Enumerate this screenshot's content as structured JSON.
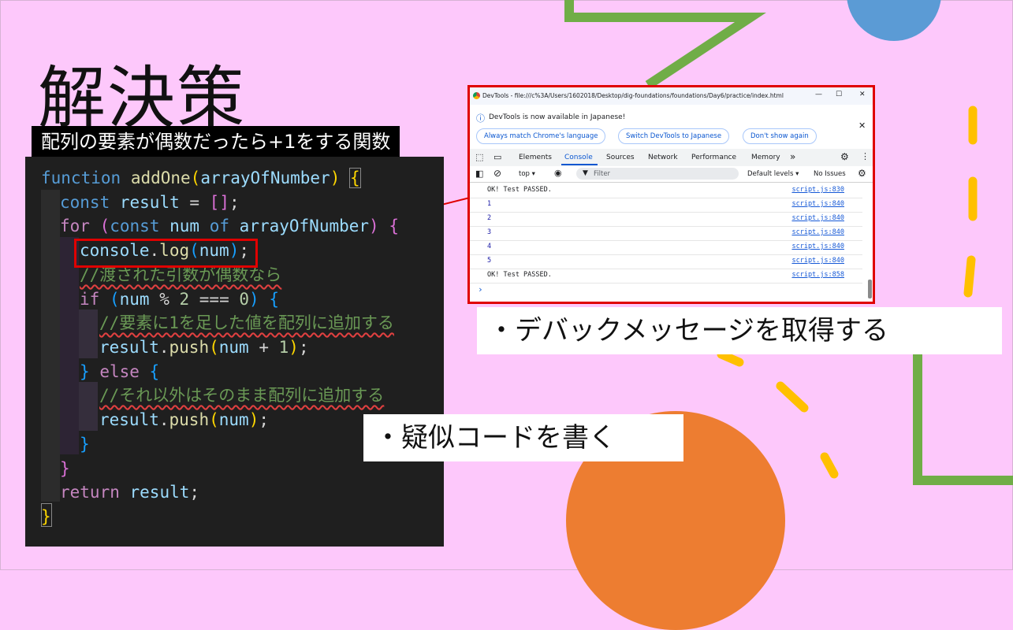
{
  "slide": {
    "title": "解決策",
    "subtitle": "配列の要素が偶数だったら+1をする関数"
  },
  "code": {
    "l1_kw": "function",
    "l1_fn": "addOne",
    "l1_open": "(",
    "l1_param": "arrayOfNumber",
    "l1_close": ")",
    "l1_brace": "{",
    "l2_kw": "const",
    "l2_var": "result",
    "l2_op": " = ",
    "l2_arr": "[]",
    "l2_semi": ";",
    "l3_kw": "for",
    "l3_open": "(",
    "l3_const": "const",
    "l3_var": "num",
    "l3_of": "of",
    "l3_param": "arrayOfNumber",
    "l3_close": ")",
    "l3_brace": "{",
    "l4_obj": "console",
    "l4_dot": ".",
    "l4_fn": "log",
    "l4_open": "(",
    "l4_var": "num",
    "l4_close": ")",
    "l4_semi": ";",
    "l5_comment": "//渡された引数が偶数なら",
    "l6_kw": "if",
    "l6_open": "(",
    "l6_var": "num",
    "l6_op1": " % ",
    "l6_n1": "2",
    "l6_op2": " === ",
    "l6_n2": "0",
    "l6_close": ")",
    "l6_brace": "{",
    "l7_comment": "//要素に1を足した値を配列に追加する",
    "l8_var": "result",
    "l8_dot": ".",
    "l8_fn": "push",
    "l8_open": "(",
    "l8_var2": "num",
    "l8_op": " + ",
    "l8_n": "1",
    "l8_close": ")",
    "l8_semi": ";",
    "l9_brace": "}",
    "l9_else": "else",
    "l9_brace2": "{",
    "l10_comment": "//それ以外はそのまま配列に追加する",
    "l11_var": "result",
    "l11_dot": ".",
    "l11_fn": "push",
    "l11_open": "(",
    "l11_var2": "num",
    "l11_close": ")",
    "l11_semi": ";",
    "l12_brace": "}",
    "l13_brace": "}",
    "l14_kw": "return",
    "l14_var": "result",
    "l14_semi": ";",
    "l15_brace": "}"
  },
  "devtools": {
    "window_title": "DevTools - file:///c%3A/Users/1602018/Desktop/dig-foundations/foundations/Day6/practice/index.html",
    "minimize_glyph": "—",
    "maximize_glyph": "☐",
    "close_glyph": "✕",
    "info_glyph": "ⓘ",
    "info_text": "DevTools is now available in Japanese!",
    "chip_match": "Always match Chrome's language",
    "chip_switch": "Switch DevTools to Japanese",
    "chip_dont": "Don't show again",
    "dismiss_glyph": "✕",
    "tabs": [
      "Elements",
      "Console",
      "Sources",
      "Network",
      "Performance",
      "Memory"
    ],
    "more_tabs_glyph": "»",
    "context": "top ▾",
    "filter_placeholder": "Filter",
    "levels": "Default levels ▾",
    "issues": "No Issues",
    "prompt_glyph": "›",
    "logs": [
      {
        "msg": "OK! Test PASSED.",
        "src": "script.js:830",
        "kind": "text"
      },
      {
        "msg": "1",
        "src": "script.js:840",
        "kind": "num"
      },
      {
        "msg": "2",
        "src": "script.js:840",
        "kind": "num"
      },
      {
        "msg": "3",
        "src": "script.js:840",
        "kind": "num"
      },
      {
        "msg": "4",
        "src": "script.js:840",
        "kind": "num"
      },
      {
        "msg": "5",
        "src": "script.js:840",
        "kind": "num"
      },
      {
        "msg": "OK! Test PASSED.",
        "src": "script.js:858",
        "kind": "text"
      }
    ]
  },
  "callouts": {
    "debug": "・デバックメッセージを取得する",
    "pseudo": "・疑似コードを書く"
  },
  "colors": {
    "background": "#fdc8fb",
    "accent_green": "#70ad47",
    "accent_yellow": "#ffc000",
    "accent_orange": "#ed7d31",
    "accent_blue": "#5b9bd5",
    "highlight_red": "#e00000"
  }
}
